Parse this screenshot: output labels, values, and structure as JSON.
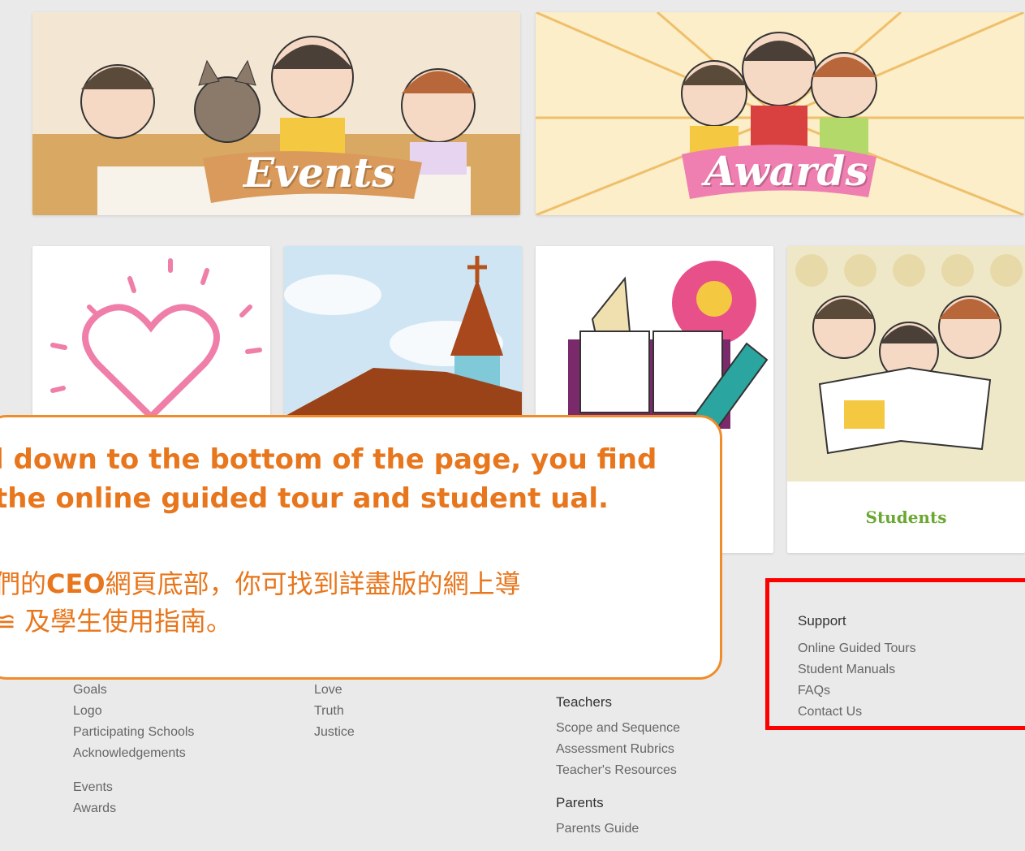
{
  "banners": {
    "events": {
      "title": "Events"
    },
    "awards": {
      "title": "Awards"
    }
  },
  "tiles": {
    "students": {
      "label": "Students"
    }
  },
  "callout": {
    "english_text": "l down to the bottom of the page, you find the online guided tour and student ual.",
    "chinese_line1_prefix": "們的",
    "chinese_bold": "CEO",
    "chinese_line1_suffix": "網頁底部，你可找到詳盡版的網上導",
    "chinese_line2": "≌ 及學生使用指南。"
  },
  "footer": {
    "about": {
      "items_top": [
        "Goals",
        "Logo",
        "Participating Schools",
        "Acknowledgements"
      ],
      "items_bottom": [
        "Events",
        "Awards"
      ]
    },
    "values": {
      "items": [
        "Love",
        "Truth",
        "Justice"
      ]
    },
    "teachers": {
      "heading": "Teachers",
      "items": [
        "Scope and Sequence",
        "Assessment Rubrics",
        "Teacher's Resources"
      ]
    },
    "parents": {
      "heading": "Parents",
      "items": [
        "Parents Guide"
      ]
    },
    "support": {
      "heading": "Support",
      "items": [
        "Online Guided Tours",
        "Student Manuals",
        "FAQs",
        "Contact Us"
      ]
    }
  },
  "colors": {
    "callout_border": "#f08c2a",
    "callout_text": "#e8761c",
    "highlight_box": "#ff0000",
    "students_label": "#6aa832",
    "page_bg": "#eaeaea"
  }
}
